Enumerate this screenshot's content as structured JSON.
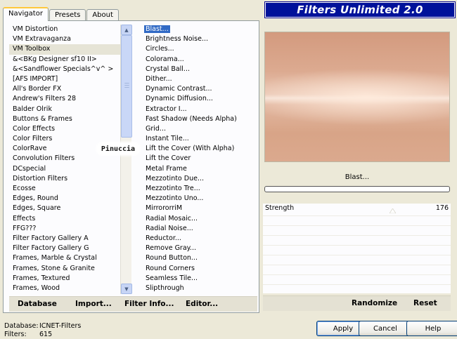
{
  "tabs": [
    "Navigator",
    "Presets",
    "About"
  ],
  "banner_title": "Filters Unlimited 2.0",
  "categories": [
    "VM Distortion",
    "VM Extravaganza",
    "VM Toolbox",
    "&<BKg Designer sf10 II>",
    "&<Sandflower Specials^v^ >",
    "[AFS IMPORT]",
    "All's Border FX",
    "Andrew's Filters 28",
    "Balder Olrik",
    "Buttons & Frames",
    "Color Effects",
    "Color Filters",
    "ColorRave",
    "Convolution Filters",
    "DCspecial",
    "Distortion Filters",
    "Ecosse",
    "Edges, Round",
    "Edges, Square",
    "Effects",
    "FFG???",
    "Filter Factory Gallery A",
    "Filter Factory Gallery G",
    "Frames, Marble & Crystal",
    "Frames, Stone & Granite",
    "Frames, Textured",
    "Frames, Wood"
  ],
  "selected_category_index": 2,
  "filters": [
    "Blast...",
    "Brightness Noise...",
    "Circles...",
    "Colorama...",
    "Crystal Ball...",
    "Dither...",
    "Dynamic Contrast...",
    "Dynamic Diffusion...",
    "Extractor I...",
    "Fast Shadow (Needs Alpha)",
    "Grid...",
    "Instant Tile...",
    "Lift the Cover (With Alpha)",
    "Lift the Cover",
    "Metal Frame",
    "Mezzotinto Due...",
    "Mezzotinto Tre...",
    "Mezzotinto Uno...",
    "MirrororriM",
    "Radial Mosaic...",
    "Radial Noise...",
    "Reductor...",
    "Remove Gray...",
    "Round Button...",
    "Round Corners",
    "Seamless Tile...",
    "Slipthrough"
  ],
  "selected_filter_index": 0,
  "watermark": "Pinuccia",
  "left_buttons": {
    "database": "Database",
    "import": "Import...",
    "filter_info": "Filter Info...",
    "editor": "Editor..."
  },
  "preview": {
    "filter_name": "Blast...",
    "progress": 0
  },
  "params": {
    "strength_label": "Strength",
    "strength_value": "176"
  },
  "right_buttons": {
    "randomize": "Randomize",
    "reset": "Reset"
  },
  "footer": {
    "database_label": "Database:",
    "database_value": "ICNET-Filters",
    "filters_label": "Filters:",
    "filters_value": "615"
  },
  "dialog_buttons": {
    "apply": "Apply",
    "cancel": "Cancel",
    "help": "Help"
  },
  "colors": {
    "banner_bg": "#00119a",
    "selection": "#316ac5",
    "tab_accent": "#ffc83c"
  }
}
